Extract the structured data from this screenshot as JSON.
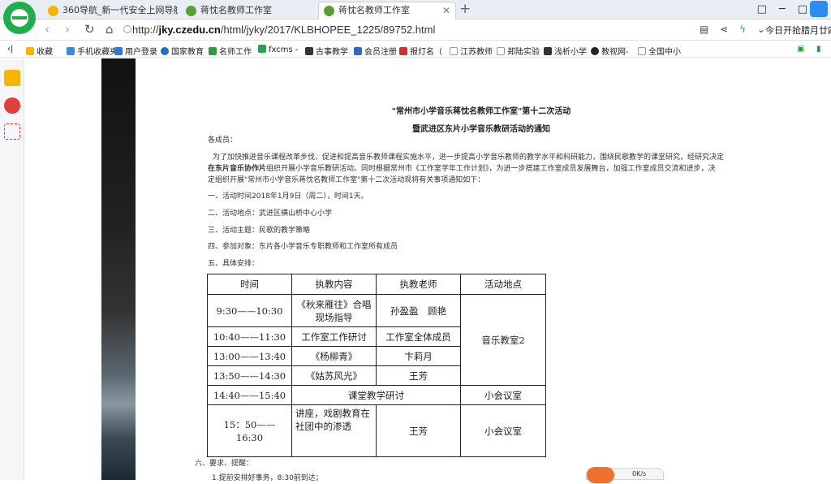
{
  "tabs": [
    {
      "label": "360导航_新一代安全上网导航",
      "active": false,
      "favicon_color": "#f7b500"
    },
    {
      "label": "蒋忱名教师工作室",
      "active": false,
      "favicon_color": "#5aa02c"
    },
    {
      "label": "蒋忱名教师工作室",
      "active": true,
      "favicon_color": "#5aa02c"
    }
  ],
  "tab_close": "✕",
  "new_tab": "+",
  "window_controls": [
    "□",
    "─",
    "□",
    "✕"
  ],
  "address": {
    "url_prefix": "http://",
    "url_domain": "jky.czedu.cn",
    "url_path": "/html/jyky/2017/KLBHOPEE_1225/89752.html",
    "right_text": "今日开抢腊月廿四"
  },
  "nav_icons": {
    "back": "‹",
    "forward": "›",
    "refresh": "↻",
    "home": "⌂"
  },
  "bookmarks": [
    "收藏",
    "手机收藏夹",
    "用户登录",
    "国家教育",
    "名师工作",
    "fxcms -",
    "古事教学",
    "会员注册",
    "报灯名（",
    "江苏教师",
    "郑陆实验",
    "浅析小学",
    "教视网-",
    "全国中小"
  ],
  "article": {
    "title1": "\"常州市小学音乐蒋忱名教师工作室\"第十二次活动",
    "title2": "暨武进区东片小学音乐教研活动的通知",
    "greeting": "各成员：",
    "para1_a": "为了加快推进音乐课程改革步伐，促进和提高音乐教师课程实施水平，进一步提高小学音乐教师的教学水平和科研能力，围绕民歌教学的课堂研究，经研究决定",
    "para1_b_bold": "在东片音乐协作片",
    "para1_b": "组织开展小学音乐教研活动。同时根据常州市《工作室学年工作计划》，为进一步搭建工作室成员发展舞台，加强工作室成员交流和进步，决",
    "para1_c": "定组织开展\"常州市小学音乐蒋忱名教师工作室\"第十二次活动现将有关事项通知如下：",
    "item1": "一、活动时间2018年1月9日（周二），时间1天。",
    "item2": "二、活动地点：武进区横山桥中心小学",
    "item3": "三、活动主题：民歌的教学策略",
    "item4": "四、参加对象：东片各小学音乐专职教师和工作室所有成员",
    "item5": "五、具体安排：",
    "item6": "六、要求、提醒：",
    "item7": "1.提前安排好事务，8:30前到达；"
  },
  "schedule": {
    "headers": [
      "时间",
      "执教内容",
      "执教老师",
      "活动地点"
    ],
    "rows": [
      {
        "time": "9:30——10:30",
        "content": "《秋来雁往》合唱现场指导",
        "teacher": "孙盈盈　顾艳"
      },
      {
        "time": "10:40——11:30",
        "content": "工作室工作研讨",
        "teacher": "工作室全体成员"
      },
      {
        "time": "13:00——13:40",
        "content": "《杨柳青》",
        "teacher": "卞莉月"
      },
      {
        "time": "13:50——14:30",
        "content": "《姑苏风光》",
        "teacher": "王芳"
      },
      {
        "time": "14:40——15:40",
        "content_span": "课堂教学研讨",
        "place": "小会议室"
      },
      {
        "time": "15：50——16:30",
        "content": "讲座，戏剧教育在社团中的渗透",
        "teacher": "王芳",
        "place": "小会议室"
      }
    ],
    "merged_place": "音乐教室2"
  },
  "widget": {
    "speed": "0K/s"
  }
}
